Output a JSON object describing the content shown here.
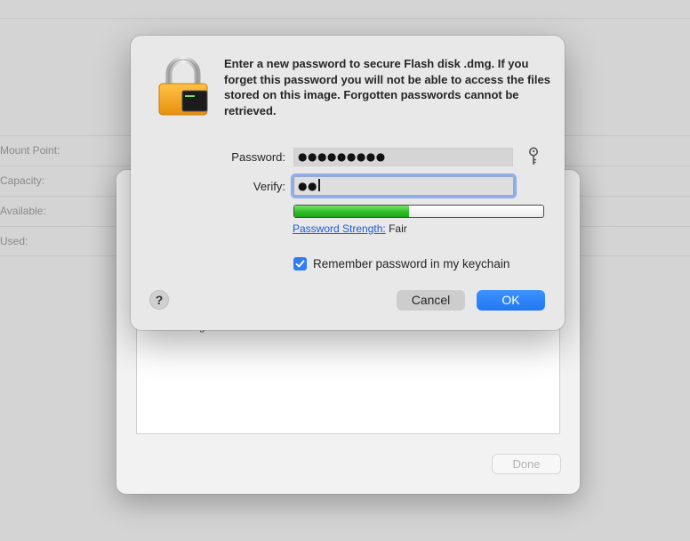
{
  "background_window": {
    "rows": [
      {
        "label": "Mount Point:"
      },
      {
        "label": "Capacity:"
      },
      {
        "label": "Available:"
      },
      {
        "label": "Used:"
      }
    ]
  },
  "sheet": {
    "log_text": "Unmounting “Flash disk”",
    "done_label": "Done"
  },
  "dialog": {
    "icon": "lock-icon",
    "message": "Enter a new password to secure Flash disk .dmg. If you forget this password you will not be able to access the files stored on this image. Forgotten passwords cannot be retrieved.",
    "password_label": "Password:",
    "password_value": "●●●●●●●●●",
    "verify_label": "Verify:",
    "verify_value": "●●",
    "strength_fraction": 0.46,
    "strength_link": "Password Strength:",
    "strength_value": "Fair",
    "remember_label": "Remember password in my keychain",
    "remember_checked": true,
    "help_label": "?",
    "cancel_label": "Cancel",
    "ok_label": "OK"
  },
  "colors": {
    "accent": "#2f7cf6",
    "strength_green": "#33c22a",
    "link": "#1e5bd8"
  }
}
